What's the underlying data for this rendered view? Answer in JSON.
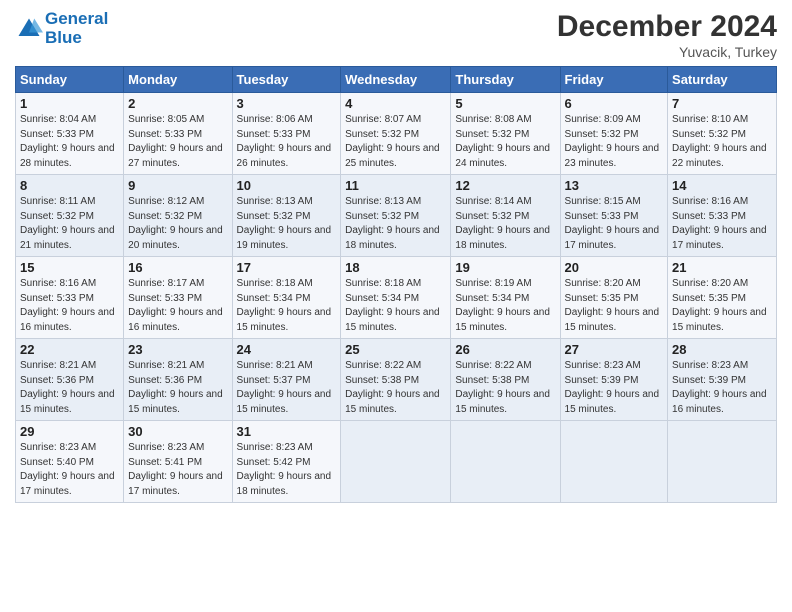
{
  "logo": {
    "line1": "General",
    "line2": "Blue"
  },
  "title": "December 2024",
  "subtitle": "Yuvacik, Turkey",
  "weekdays": [
    "Sunday",
    "Monday",
    "Tuesday",
    "Wednesday",
    "Thursday",
    "Friday",
    "Saturday"
  ],
  "weeks": [
    [
      {
        "day": 1,
        "sunrise": "8:04 AM",
        "sunset": "5:33 PM",
        "daylight": "9 hours and 28 minutes."
      },
      {
        "day": 2,
        "sunrise": "8:05 AM",
        "sunset": "5:33 PM",
        "daylight": "9 hours and 27 minutes."
      },
      {
        "day": 3,
        "sunrise": "8:06 AM",
        "sunset": "5:33 PM",
        "daylight": "9 hours and 26 minutes."
      },
      {
        "day": 4,
        "sunrise": "8:07 AM",
        "sunset": "5:32 PM",
        "daylight": "9 hours and 25 minutes."
      },
      {
        "day": 5,
        "sunrise": "8:08 AM",
        "sunset": "5:32 PM",
        "daylight": "9 hours and 24 minutes."
      },
      {
        "day": 6,
        "sunrise": "8:09 AM",
        "sunset": "5:32 PM",
        "daylight": "9 hours and 23 minutes."
      },
      {
        "day": 7,
        "sunrise": "8:10 AM",
        "sunset": "5:32 PM",
        "daylight": "9 hours and 22 minutes."
      }
    ],
    [
      {
        "day": 8,
        "sunrise": "8:11 AM",
        "sunset": "5:32 PM",
        "daylight": "9 hours and 21 minutes."
      },
      {
        "day": 9,
        "sunrise": "8:12 AM",
        "sunset": "5:32 PM",
        "daylight": "9 hours and 20 minutes."
      },
      {
        "day": 10,
        "sunrise": "8:13 AM",
        "sunset": "5:32 PM",
        "daylight": "9 hours and 19 minutes."
      },
      {
        "day": 11,
        "sunrise": "8:13 AM",
        "sunset": "5:32 PM",
        "daylight": "9 hours and 18 minutes."
      },
      {
        "day": 12,
        "sunrise": "8:14 AM",
        "sunset": "5:32 PM",
        "daylight": "9 hours and 18 minutes."
      },
      {
        "day": 13,
        "sunrise": "8:15 AM",
        "sunset": "5:33 PM",
        "daylight": "9 hours and 17 minutes."
      },
      {
        "day": 14,
        "sunrise": "8:16 AM",
        "sunset": "5:33 PM",
        "daylight": "9 hours and 17 minutes."
      }
    ],
    [
      {
        "day": 15,
        "sunrise": "8:16 AM",
        "sunset": "5:33 PM",
        "daylight": "9 hours and 16 minutes."
      },
      {
        "day": 16,
        "sunrise": "8:17 AM",
        "sunset": "5:33 PM",
        "daylight": "9 hours and 16 minutes."
      },
      {
        "day": 17,
        "sunrise": "8:18 AM",
        "sunset": "5:34 PM",
        "daylight": "9 hours and 15 minutes."
      },
      {
        "day": 18,
        "sunrise": "8:18 AM",
        "sunset": "5:34 PM",
        "daylight": "9 hours and 15 minutes."
      },
      {
        "day": 19,
        "sunrise": "8:19 AM",
        "sunset": "5:34 PM",
        "daylight": "9 hours and 15 minutes."
      },
      {
        "day": 20,
        "sunrise": "8:20 AM",
        "sunset": "5:35 PM",
        "daylight": "9 hours and 15 minutes."
      },
      {
        "day": 21,
        "sunrise": "8:20 AM",
        "sunset": "5:35 PM",
        "daylight": "9 hours and 15 minutes."
      }
    ],
    [
      {
        "day": 22,
        "sunrise": "8:21 AM",
        "sunset": "5:36 PM",
        "daylight": "9 hours and 15 minutes."
      },
      {
        "day": 23,
        "sunrise": "8:21 AM",
        "sunset": "5:36 PM",
        "daylight": "9 hours and 15 minutes."
      },
      {
        "day": 24,
        "sunrise": "8:21 AM",
        "sunset": "5:37 PM",
        "daylight": "9 hours and 15 minutes."
      },
      {
        "day": 25,
        "sunrise": "8:22 AM",
        "sunset": "5:38 PM",
        "daylight": "9 hours and 15 minutes."
      },
      {
        "day": 26,
        "sunrise": "8:22 AM",
        "sunset": "5:38 PM",
        "daylight": "9 hours and 15 minutes."
      },
      {
        "day": 27,
        "sunrise": "8:23 AM",
        "sunset": "5:39 PM",
        "daylight": "9 hours and 15 minutes."
      },
      {
        "day": 28,
        "sunrise": "8:23 AM",
        "sunset": "5:39 PM",
        "daylight": "9 hours and 16 minutes."
      }
    ],
    [
      {
        "day": 29,
        "sunrise": "8:23 AM",
        "sunset": "5:40 PM",
        "daylight": "9 hours and 17 minutes."
      },
      {
        "day": 30,
        "sunrise": "8:23 AM",
        "sunset": "5:41 PM",
        "daylight": "9 hours and 17 minutes."
      },
      {
        "day": 31,
        "sunrise": "8:23 AM",
        "sunset": "5:42 PM",
        "daylight": "9 hours and 18 minutes."
      },
      null,
      null,
      null,
      null
    ]
  ]
}
